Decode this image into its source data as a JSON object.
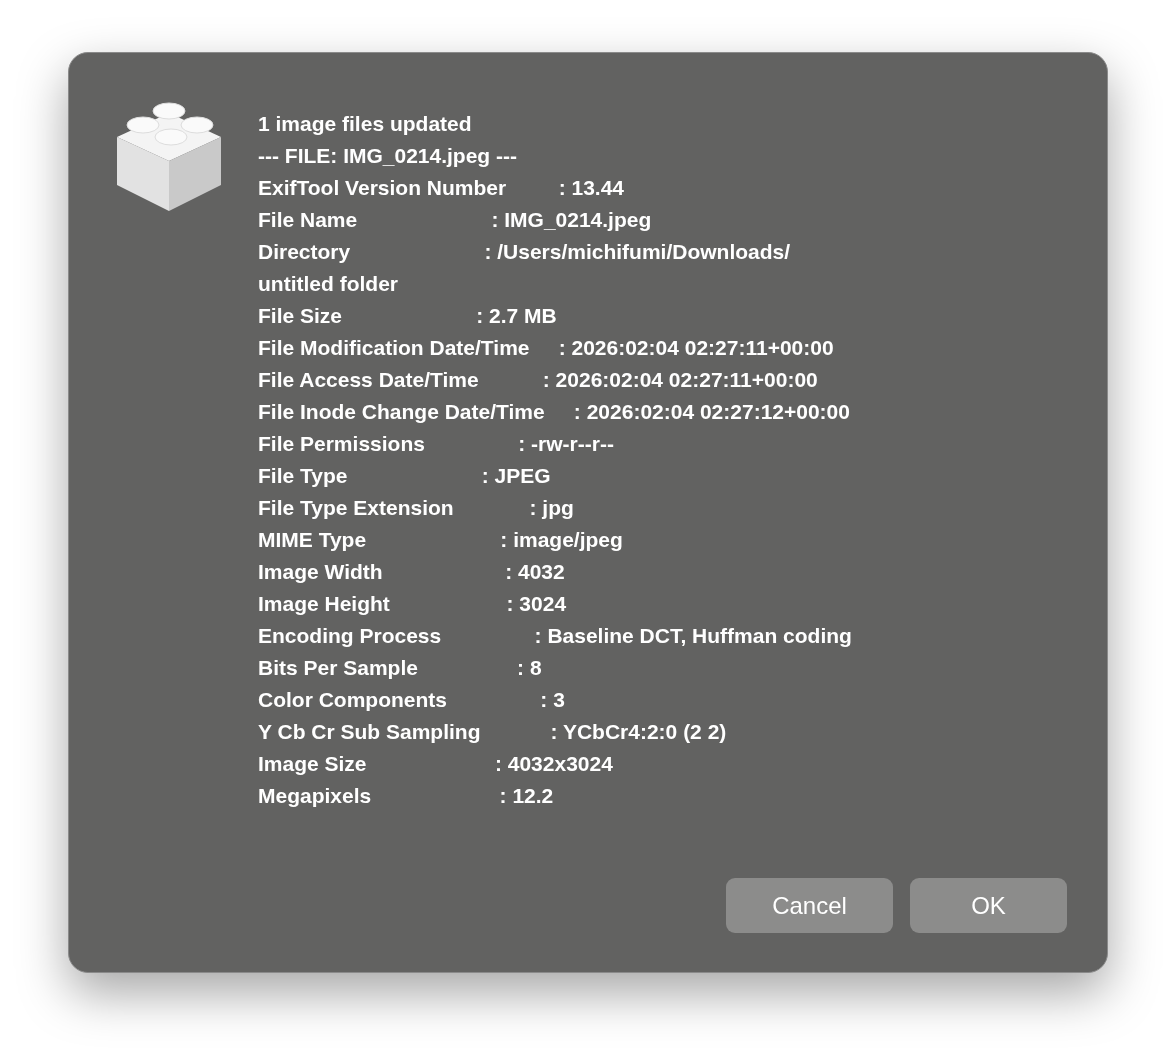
{
  "dialog": {
    "lines": [
      "1 image files updated",
      "--- FILE: IMG_0214.jpeg ---",
      "ExifTool Version Number         : 13.44",
      "File Name                       : IMG_0214.jpeg",
      "Directory                       : /Users/michifumi/Downloads/",
      "untitled folder",
      "File Size                       : 2.7 MB",
      "File Modification Date/Time     : 2026:02:04 02:27:11+00:00",
      "File Access Date/Time           : 2026:02:04 02:27:11+00:00",
      "File Inode Change Date/Time     : 2026:02:04 02:27:12+00:00",
      "File Permissions                : -rw-r--r--",
      "File Type                       : JPEG",
      "File Type Extension             : jpg",
      "MIME Type                       : image/jpeg",
      "Image Width                     : 4032",
      "Image Height                    : 3024",
      "Encoding Process                : Baseline DCT, Huffman coding",
      "Bits Per Sample                 : 8",
      "Color Components                : 3",
      "Y Cb Cr Sub Sampling            : YCbCr4:2:0 (2 2)",
      "Image Size                      : 4032x3024",
      "Megapixels                      : 12.2"
    ],
    "buttons": [
      "Cancel",
      "OK"
    ]
  }
}
